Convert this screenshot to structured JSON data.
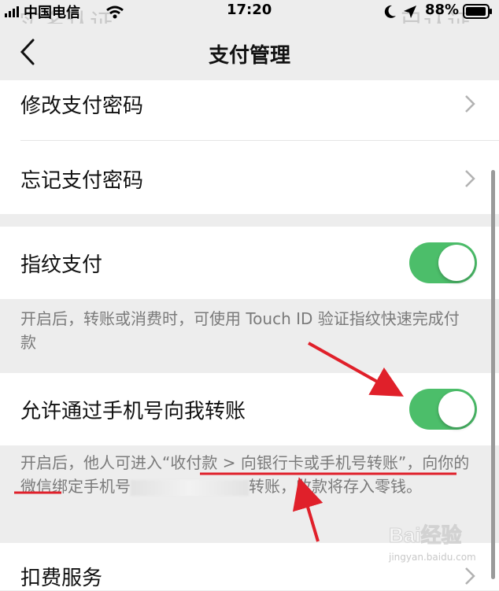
{
  "status_bar": {
    "carrier": "中国电信",
    "time": "17:20",
    "battery": "88%"
  },
  "ghost_header": {
    "left": "实名认证",
    "right": "已认证"
  },
  "nav": {
    "title": "支付管理"
  },
  "items": {
    "change_password": "修改支付密码",
    "forgot_password": "忘记支付密码",
    "fingerprint_pay": "指纹支付",
    "fingerprint_note": "开启后，转账或消费时，可使用 Touch ID 验证指纹快速完成付款",
    "phone_transfer": "允许通过手机号向我转账",
    "phone_transfer_note_a": "开启后，他人可进入“收付款 > 向银行卡或手机号转账”，向你的微信绑定手机号",
    "phone_transfer_note_b": "转账，收款将存入零钱。",
    "deduction_service": "扣费服务"
  },
  "toggles": {
    "fingerprint_on": true,
    "phone_transfer_on": true,
    "on_color": "#4cbe6a"
  },
  "annotations": {
    "color": "#e0202a"
  },
  "watermark": {
    "brand": "Bai经验",
    "url": "jingyan.baidu.com"
  }
}
